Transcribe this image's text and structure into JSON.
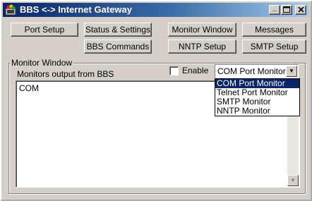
{
  "window": {
    "title": "BBS <-> Internet Gateway",
    "minimize_icon": "minimize-icon",
    "maximize_icon": "maximize-icon",
    "close_icon": "close-icon"
  },
  "toolbar": {
    "port_setup": "Port Setup",
    "status_settings": "Status & Settings",
    "monitor_window": "Monitor Window",
    "messages": "Messages",
    "bbs_commands": "BBS Commands",
    "nntp_setup": "NNTP Setup",
    "smtp_setup": "SMTP Setup"
  },
  "monitor": {
    "group_title": "Monitor Window",
    "subtitle": "Monitors output from BBS",
    "enable_label": "Enable",
    "enable_checked": false,
    "selected": "COM Port Monitor",
    "options": [
      "COM Port Monitor",
      "Telnet Port Monitor",
      "SMTP Monitor",
      "NNTP Monitor"
    ],
    "output_text": "COM"
  },
  "colors": {
    "titlebar_start": "#0a246a",
    "titlebar_end": "#a6caf0",
    "face": "#d4d0c8",
    "selection": "#0a246a"
  }
}
